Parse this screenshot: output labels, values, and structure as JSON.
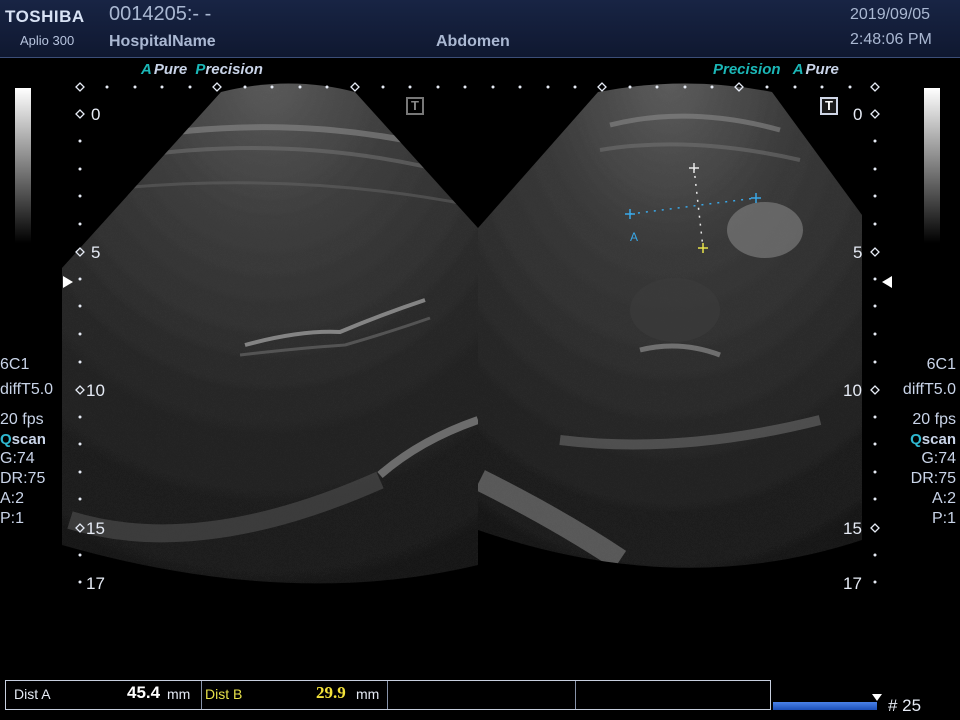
{
  "header": {
    "brand": "TOSHIBA",
    "model": "Aplio 300",
    "patient_id": "0014205:- -",
    "hospital": "HospitalName",
    "preset": "Abdomen",
    "date": "2019/09/05",
    "time": "2:48:06 PM"
  },
  "left_image": {
    "indicator_a": "A",
    "indicator_pure": "Pure",
    "indicator_precision_p": "P",
    "indicator_precision_rest": "recision",
    "depth_labels": [
      "0",
      "5",
      "10",
      "15",
      "17"
    ],
    "params": {
      "probe": "6C1",
      "mode": "diffT5.0",
      "fps": "20 fps",
      "qscan_q": "Q",
      "qscan_rest": "scan",
      "gain": "G:74",
      "dr": "DR:75",
      "a": "A:2",
      "p": "P:1"
    },
    "t_mark": "T"
  },
  "right_image": {
    "indicator_precision": "Precision",
    "indicator_a": "A",
    "indicator_pure": "Pure",
    "depth_labels": [
      "0",
      "5",
      "10",
      "15",
      "17"
    ],
    "params": {
      "probe": "6C1",
      "mode": "diffT5.0",
      "fps": "20 fps",
      "qscan_q": "Q",
      "qscan_rest": "scan",
      "gain": "G:74",
      "dr": "DR:75",
      "a": "A:2",
      "p": "P:1"
    },
    "t_mark": "T",
    "caliper_label": "A"
  },
  "measurements": {
    "dist_a_label": "Dist A",
    "dist_a_value": "45.4",
    "dist_a_unit": "mm",
    "dist_b_label": "Dist B",
    "dist_b_value": "29.9",
    "dist_b_unit": "mm"
  },
  "cine": {
    "frame": "# 25",
    "position": 1.0
  },
  "colors": {
    "caliper_a": "#3aa8e8",
    "caliper_b": "#e8e24a",
    "indicator_accent": "#1bb7b7",
    "header_bg": "#182444"
  }
}
